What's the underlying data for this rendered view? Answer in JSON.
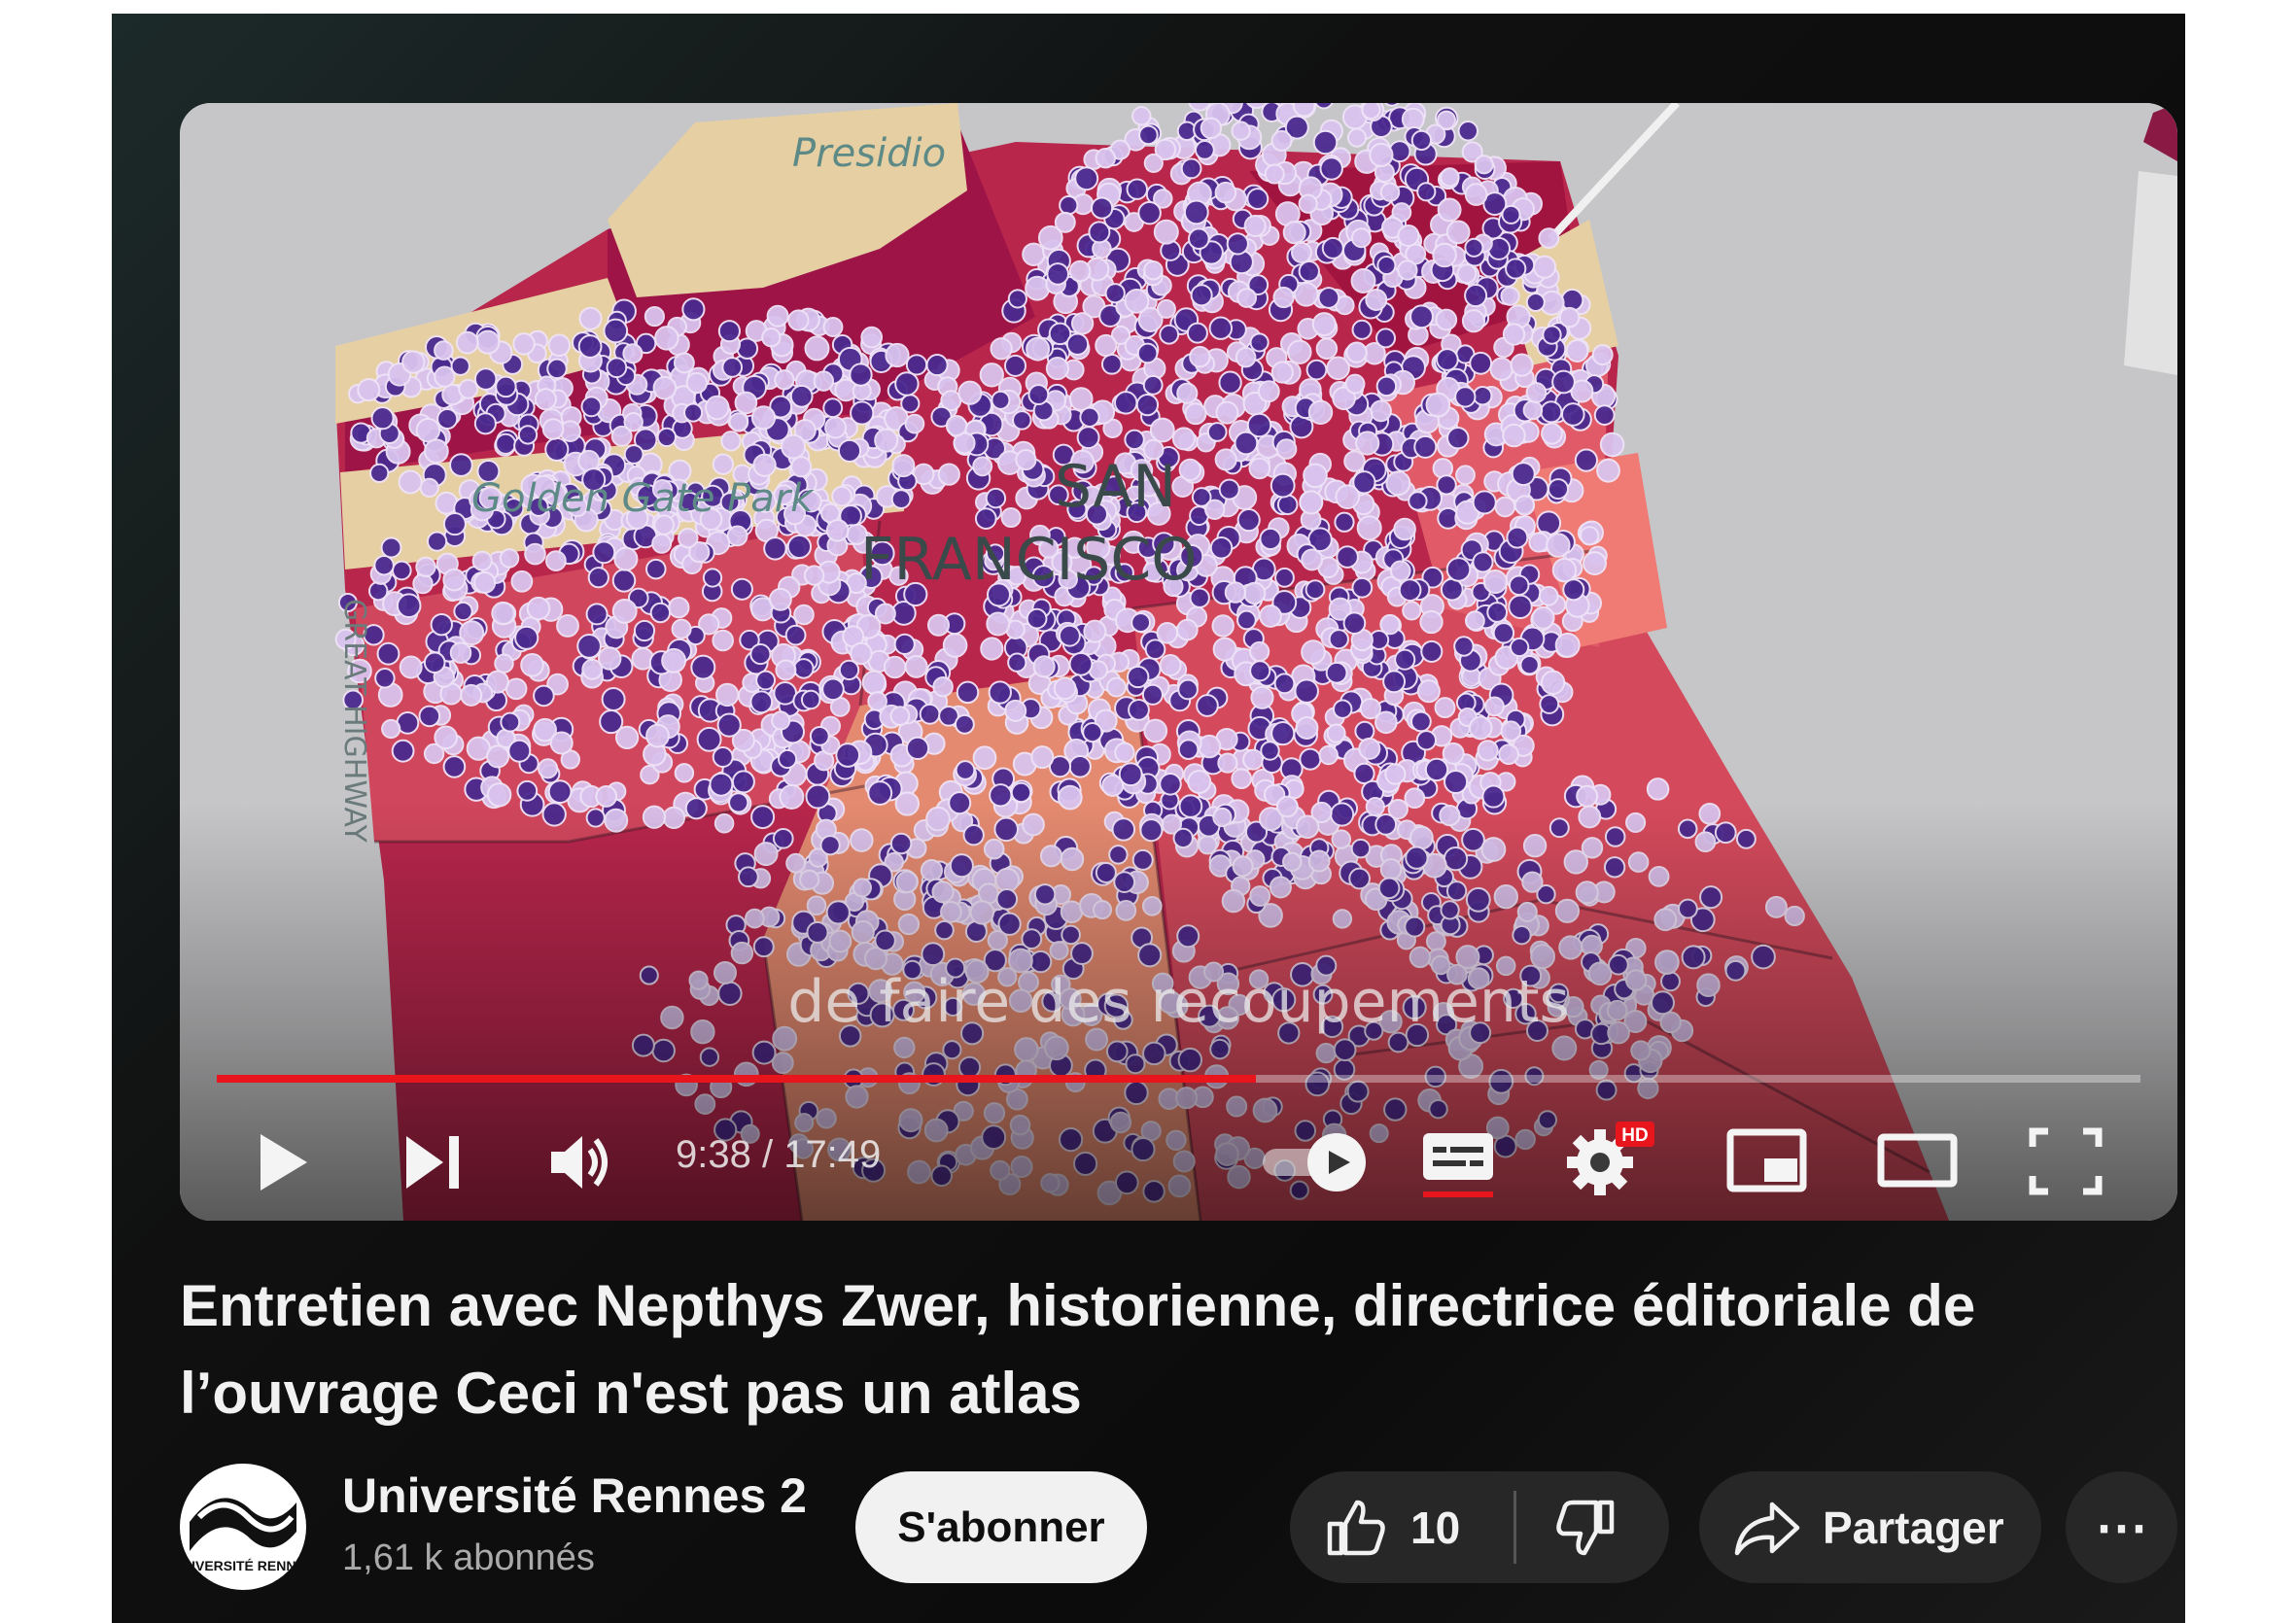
{
  "video": {
    "caption": "de faire des recoupements",
    "time_display": "9:38 / 17:49",
    "progress": 0.54,
    "map_labels": {
      "presidio": "Presidio",
      "park": "Golden Gate Park",
      "city_line1": "SAN",
      "city_line2": "FRANCISCO",
      "highway": "GREAT HIGHWAY"
    },
    "hd_badge": "HD",
    "icons": [
      "play-icon",
      "next-icon",
      "volume-icon",
      "autoplay-toggle",
      "subtitles-icon",
      "settings-icon",
      "miniplayer-icon",
      "theater-icon",
      "fullscreen-icon"
    ]
  },
  "title": "Entretien avec Nepthys Zwer, historienne, directrice éditoriale de l’ouvrage Ceci n'est pas un atlas",
  "channel": {
    "name": "Université Rennes 2",
    "subscribers": "1,61 k abonnés",
    "avatar_text": "UNIVERSITÉ RENNES"
  },
  "actions": {
    "subscribe": "S'abonner",
    "like_count": "10",
    "share": "Partager",
    "more": "⋯"
  },
  "colors": {
    "progress": "#e8161c",
    "background": "#0f0f0f",
    "pill": "#272727",
    "dot_dark": "#4b2a8f",
    "dot_light": "#d9c3ee"
  }
}
